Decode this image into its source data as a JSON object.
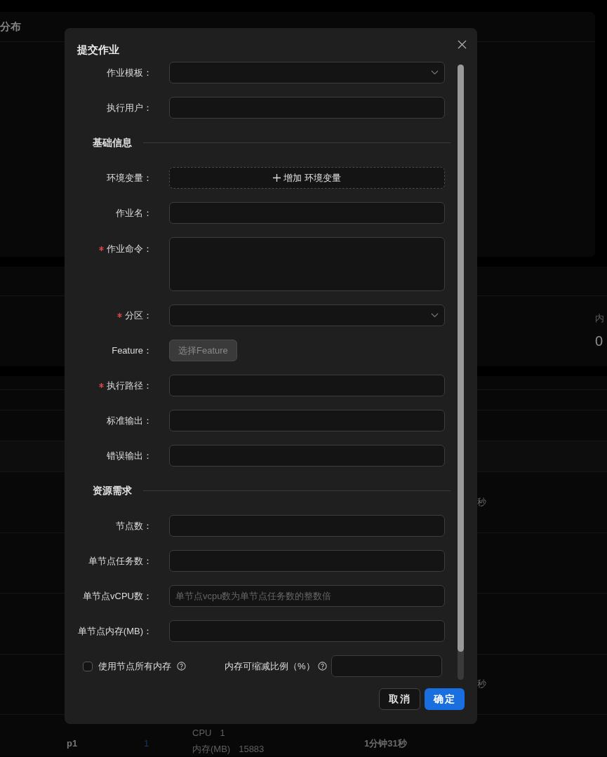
{
  "background": {
    "panel_title": "分布",
    "stat_label": "内",
    "stat_value": "0",
    "cells": [
      "秒",
      "秒"
    ],
    "row": {
      "partition": "p1",
      "count": "1",
      "cpu_label": "CPU",
      "cpu_value": "1",
      "mem_label": "内存(MB)",
      "mem_value": "15883",
      "duration": "1分钟31秒"
    }
  },
  "dialog": {
    "title": "提交作业",
    "fields": [
      {
        "kind": "select",
        "label": "作业模板：",
        "required": false
      },
      {
        "kind": "input",
        "label": "执行用户：",
        "required": false
      },
      {
        "kind": "section",
        "label": "基础信息"
      },
      {
        "kind": "add",
        "label": "环境变量：",
        "required": false,
        "button": "增加 环境变量"
      },
      {
        "kind": "input",
        "label": "作业名：",
        "required": false
      },
      {
        "kind": "textarea",
        "label": "作业命令：",
        "required": true
      },
      {
        "kind": "select",
        "label": "分区：",
        "required": true
      },
      {
        "kind": "button",
        "label": "Feature：",
        "required": false,
        "button": "选择Feature",
        "disabled": true
      },
      {
        "kind": "input",
        "label": "执行路径：",
        "required": true
      },
      {
        "kind": "input",
        "label": "标准输出：",
        "required": false
      },
      {
        "kind": "input",
        "label": "错误输出：",
        "required": false
      },
      {
        "kind": "section",
        "label": "资源需求"
      },
      {
        "kind": "input",
        "label": "节点数：",
        "required": false
      },
      {
        "kind": "input",
        "label": "单节点任务数：",
        "required": false
      },
      {
        "kind": "input",
        "label": "单节点vCPU数：",
        "required": false,
        "placeholder": "单节点vcpu数为单节点任务数的整数倍"
      },
      {
        "kind": "input",
        "label": "单节点内存(MB)：",
        "required": false
      },
      {
        "kind": "pair",
        "checkbox": {
          "label": "使用节点所有内存",
          "checked": false
        },
        "label": "内存可缩减比例（%）"
      }
    ],
    "buttons": [
      {
        "label": "取消",
        "primary": false
      },
      {
        "label": "确定",
        "primary": true
      }
    ]
  }
}
